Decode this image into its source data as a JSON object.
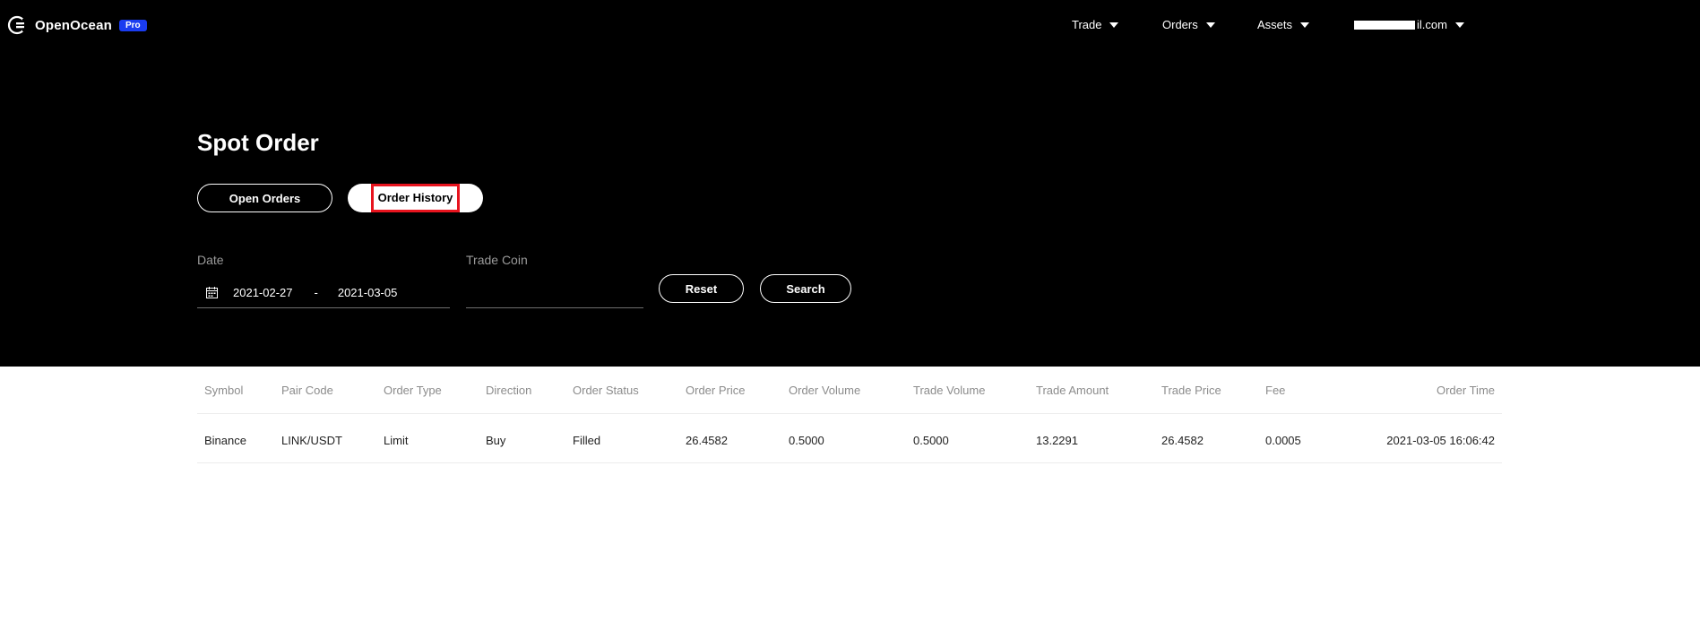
{
  "brand": {
    "name": "OpenOcean",
    "badge": "Pro"
  },
  "nav": {
    "trade": "Trade",
    "orders": "Orders",
    "assets": "Assets",
    "account_suffix": "il.com"
  },
  "page_title": "Spot Order",
  "tabs": {
    "open_orders": "Open Orders",
    "order_history": "Order History"
  },
  "filters": {
    "date_label": "Date",
    "date_start": "2021-02-27",
    "date_separator": "-",
    "date_end": "2021-03-05",
    "trade_coin_label": "Trade Coin",
    "trade_coin_value": "",
    "reset_label": "Reset",
    "search_label": "Search"
  },
  "table": {
    "columns": [
      "Symbol",
      "Pair Code",
      "Order Type",
      "Direction",
      "Order Status",
      "Order Price",
      "Order Volume",
      "Trade Volume",
      "Trade Amount",
      "Trade Price",
      "Fee",
      "Order Time"
    ],
    "rows": [
      [
        "Binance",
        "LINK/USDT",
        "Limit",
        "Buy",
        "Filled",
        "26.4582",
        "0.5000",
        "0.5000",
        "13.2291",
        "26.4582",
        "0.0005",
        "2021-03-05 16:06:42"
      ]
    ]
  },
  "colors": {
    "header_bg": "#000000",
    "badge": "#1a3cf0",
    "highlight": "#e8141e"
  }
}
